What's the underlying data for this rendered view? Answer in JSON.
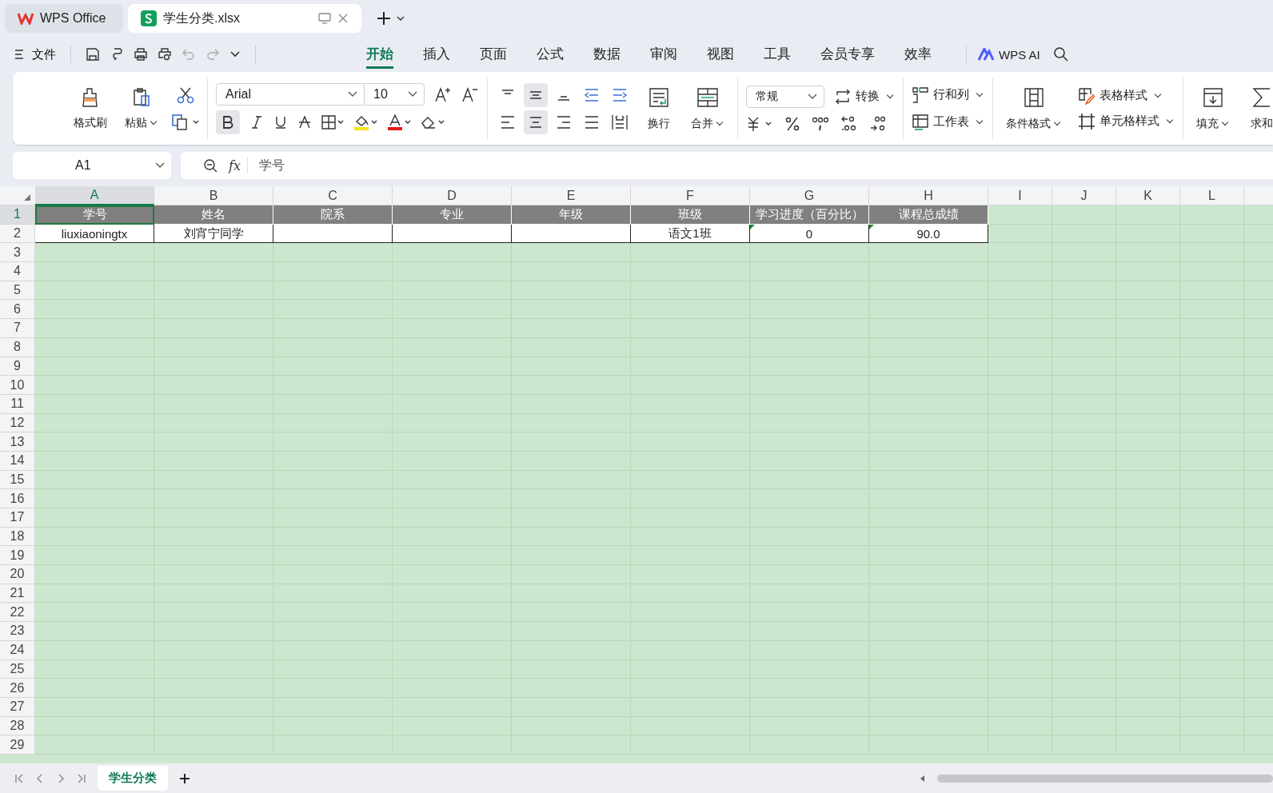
{
  "app_tabs": [
    {
      "label": "WPS Office",
      "kind": "home",
      "selected": false
    },
    {
      "label": "学生分类.xlsx",
      "kind": "sheet",
      "selected": true
    }
  ],
  "menu": {
    "file": "文件",
    "tabs": [
      {
        "label": "开始",
        "selected": true
      },
      {
        "label": "插入",
        "selected": false
      },
      {
        "label": "页面",
        "selected": false
      },
      {
        "label": "公式",
        "selected": false
      },
      {
        "label": "数据",
        "selected": false
      },
      {
        "label": "审阅",
        "selected": false
      },
      {
        "label": "视图",
        "selected": false
      },
      {
        "label": "工具",
        "selected": false
      },
      {
        "label": "会员专享",
        "selected": false
      },
      {
        "label": "效率",
        "selected": false
      }
    ],
    "ai": "WPS AI"
  },
  "ribbon": {
    "format_painter": "格式刷",
    "paste": "粘贴",
    "font": "Arial",
    "size": "10",
    "bold": true,
    "align_middle": true,
    "align_center": true,
    "wrap": "换行",
    "merge": "合并",
    "number_format": "常规",
    "convert": "转换",
    "rows_cols": "行和列",
    "worksheet": "工作表",
    "cond_format": "条件格式",
    "table_style": "表格样式",
    "cell_style": "单元格样式",
    "fill": "填充",
    "sum": "求和"
  },
  "formula_bar": {
    "name_box": "A1",
    "function_label": "fx",
    "value": "学号"
  },
  "sheet": {
    "columns": [
      {
        "label": "A",
        "selected": true
      },
      {
        "label": "B",
        "selected": false
      },
      {
        "label": "C",
        "selected": false
      },
      {
        "label": "D",
        "selected": false
      },
      {
        "label": "E",
        "selected": false
      },
      {
        "label": "F",
        "selected": false
      },
      {
        "label": "G",
        "selected": false
      },
      {
        "label": "H",
        "selected": false
      },
      {
        "label": "I",
        "selected": false
      },
      {
        "label": "J",
        "selected": false
      },
      {
        "label": "K",
        "selected": false
      },
      {
        "label": "L",
        "selected": false
      }
    ],
    "rows": [
      {
        "number": "1",
        "selected": true,
        "kind": "header",
        "cells": [
          {
            "text": "学号",
            "selected": true,
            "flag": false
          },
          {
            "text": "姓名",
            "selected": false,
            "flag": false
          },
          {
            "text": "院系",
            "selected": false,
            "flag": false
          },
          {
            "text": "专业",
            "selected": false,
            "flag": false
          },
          {
            "text": "年级",
            "selected": false,
            "flag": false
          },
          {
            "text": "班级",
            "selected": false,
            "flag": false
          },
          {
            "text": "学习进度（百分比）",
            "selected": false,
            "flag": false
          },
          {
            "text": "课程总成绩",
            "selected": false,
            "flag": false
          }
        ]
      },
      {
        "number": "2",
        "selected": false,
        "kind": "data",
        "cells": [
          {
            "text": "liuxiaoningtx",
            "selected": false,
            "flag": false
          },
          {
            "text": "刘宵宁同学",
            "selected": false,
            "flag": false
          },
          {
            "selected": false,
            "flag": false
          },
          {
            "selected": false,
            "flag": false
          },
          {
            "selected": false,
            "flag": false
          },
          {
            "text": "语文1班",
            "selected": false,
            "flag": false
          },
          {
            "text": "0",
            "selected": false,
            "flag": true
          },
          {
            "text": "90.0",
            "selected": false,
            "flag": true
          }
        ]
      },
      {
        "number": "3",
        "selected": false,
        "kind": "empty"
      },
      {
        "number": "4",
        "selected": false,
        "kind": "empty"
      },
      {
        "number": "5",
        "selected": false,
        "kind": "empty"
      },
      {
        "number": "6",
        "selected": false,
        "kind": "empty"
      },
      {
        "number": "7",
        "selected": false,
        "kind": "empty"
      },
      {
        "number": "8",
        "selected": false,
        "kind": "empty"
      },
      {
        "number": "9",
        "selected": false,
        "kind": "empty"
      },
      {
        "number": "10",
        "selected": false,
        "kind": "empty"
      },
      {
        "number": "11",
        "selected": false,
        "kind": "empty"
      },
      {
        "number": "12",
        "selected": false,
        "kind": "empty"
      },
      {
        "number": "13",
        "selected": false,
        "kind": "empty"
      },
      {
        "number": "14",
        "selected": false,
        "kind": "empty"
      },
      {
        "number": "15",
        "selected": false,
        "kind": "empty"
      },
      {
        "number": "16",
        "selected": false,
        "kind": "empty"
      },
      {
        "number": "17",
        "selected": false,
        "kind": "empty"
      },
      {
        "number": "18",
        "selected": false,
        "kind": "empty"
      },
      {
        "number": "19",
        "selected": false,
        "kind": "empty"
      },
      {
        "number": "20",
        "selected": false,
        "kind": "empty"
      },
      {
        "number": "21",
        "selected": false,
        "kind": "empty"
      },
      {
        "number": "22",
        "selected": false,
        "kind": "empty"
      },
      {
        "number": "23",
        "selected": false,
        "kind": "empty"
      },
      {
        "number": "24",
        "selected": false,
        "kind": "empty"
      },
      {
        "number": "25",
        "selected": false,
        "kind": "empty"
      },
      {
        "number": "26",
        "selected": false,
        "kind": "empty"
      },
      {
        "number": "27",
        "selected": false,
        "kind": "empty"
      },
      {
        "number": "28",
        "selected": false,
        "kind": "empty"
      },
      {
        "number": "29",
        "selected": false,
        "kind": "empty"
      }
    ]
  },
  "sheet_tabs": [
    {
      "label": "学生分类",
      "selected": true
    }
  ]
}
